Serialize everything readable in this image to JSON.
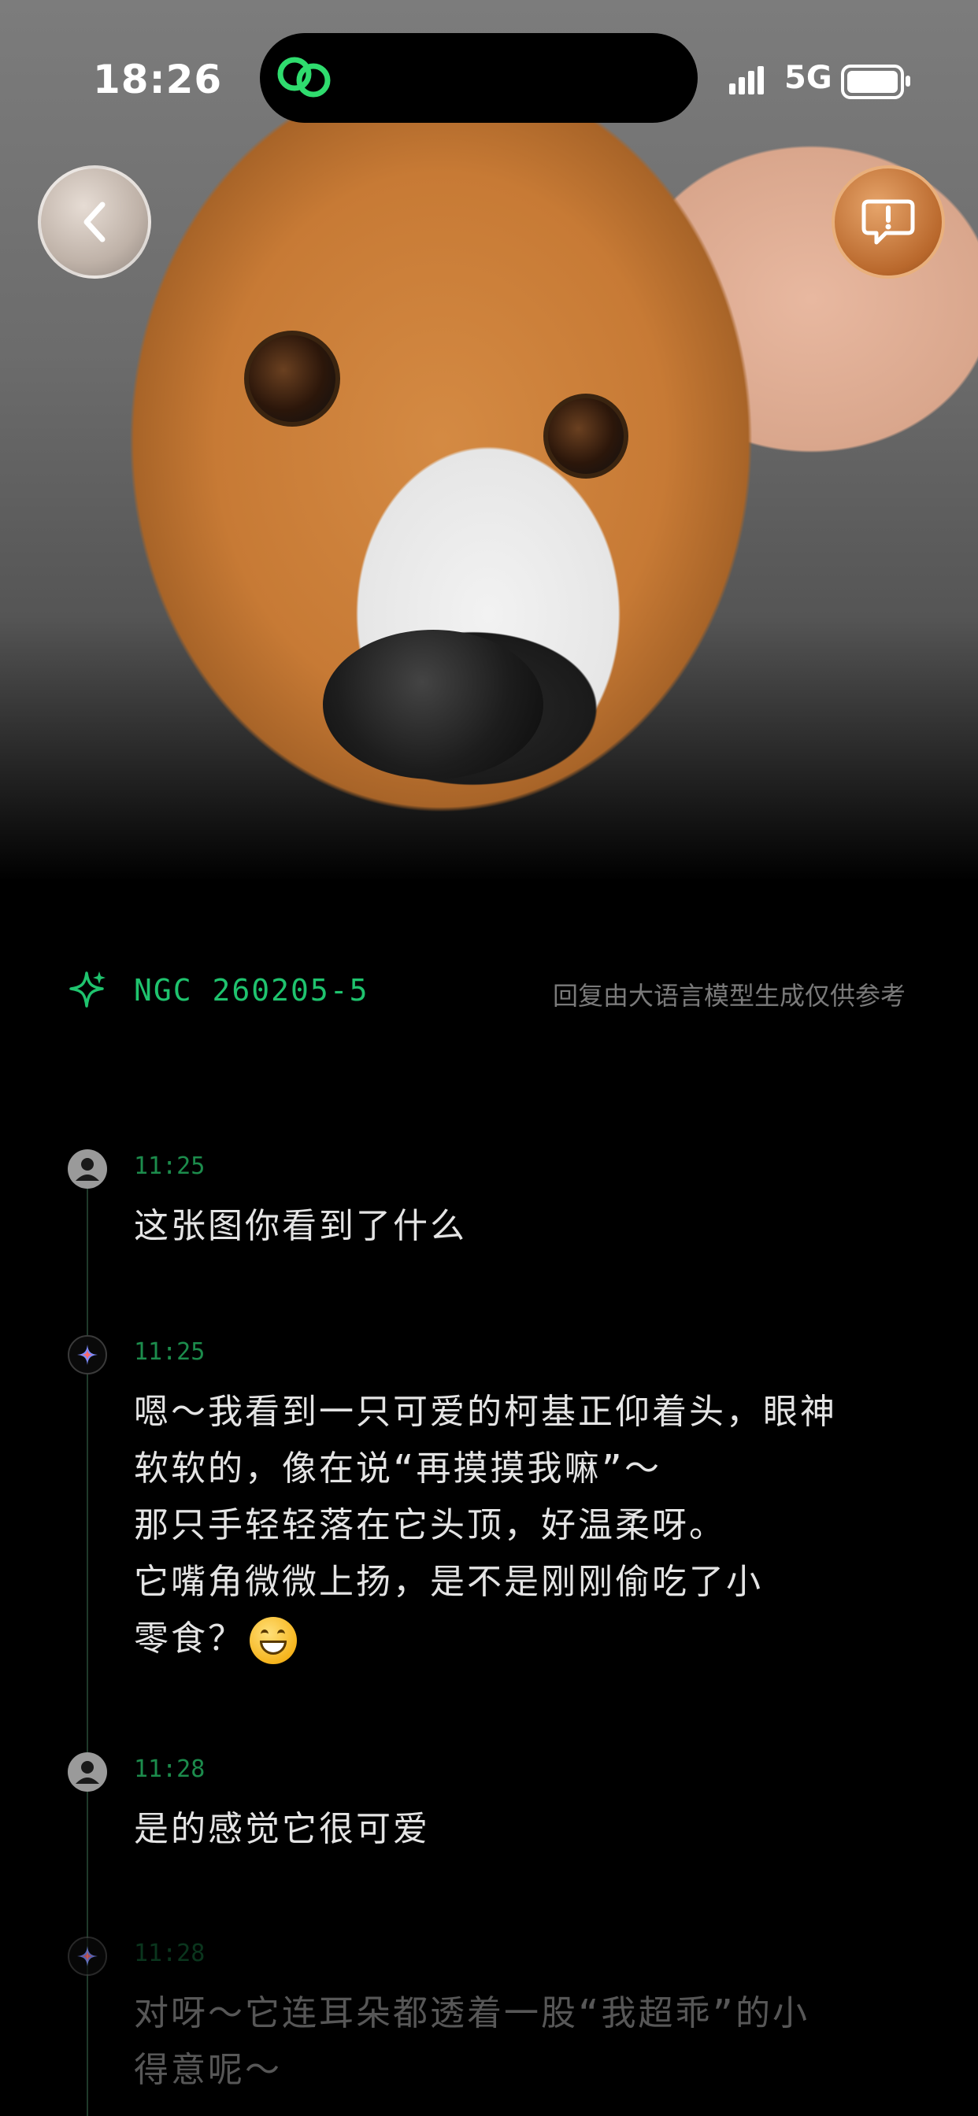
{
  "status_bar": {
    "time": "18:26",
    "network": "5G"
  },
  "header": {
    "model_name": "NGC 260205-5",
    "disclaimer": "回复由大语言模型生成仅供参考"
  },
  "icons": {
    "back": "chevron-left-icon",
    "feedback": "exclamation-bubble-icon",
    "model": "sparkle-icon",
    "user_avatar": "user-avatar-icon",
    "ai_avatar": "ai-star-icon"
  },
  "colors": {
    "accent": "#1fc36e",
    "timestamp": "#1c8c4c",
    "background": "#000000"
  },
  "messages": [
    {
      "role": "user",
      "time": "11:25",
      "text": "这张图你看到了什么"
    },
    {
      "role": "assistant",
      "time": "11:25",
      "text": "嗯～我看到一只可爱的柯基正仰着头，眼神\n软软的，像在说“再摸摸我嘛”～\n那只手轻轻落在它头顶，好温柔呀。\n它嘴角微微上扬，是不是刚刚偷吃了小\n零食？",
      "emoji": "grinning-face"
    },
    {
      "role": "user",
      "time": "11:28",
      "text": "是的感觉它很可爱"
    },
    {
      "role": "assistant",
      "time": "11:28",
      "text": "对呀～它连耳朵都透着一股“我超乖”的小\n得意呢～"
    }
  ]
}
